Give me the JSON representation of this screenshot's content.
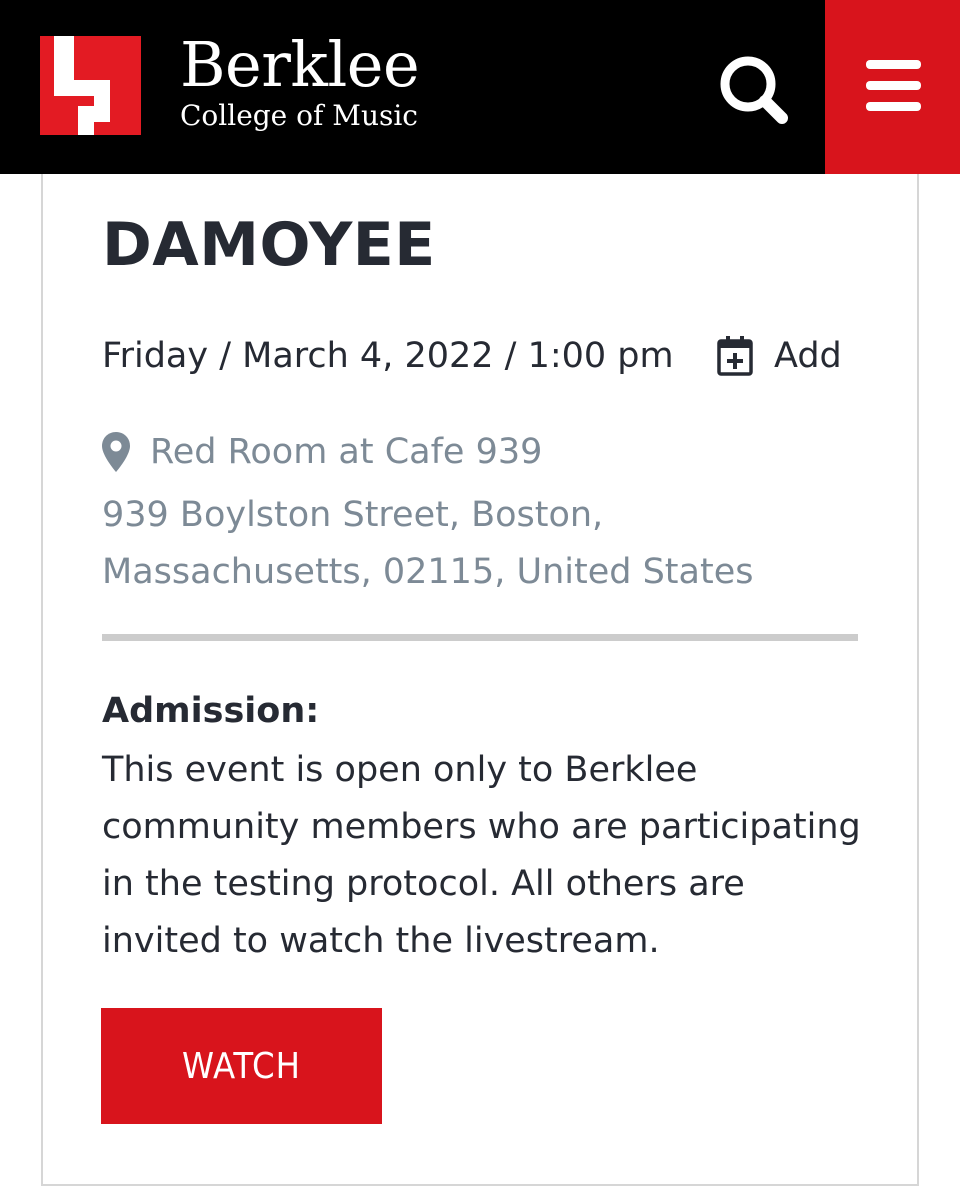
{
  "header": {
    "brand_name": "Berklee",
    "brand_sub": "College of Music",
    "logo_icon": "berklee-b-logo",
    "search_icon": "search-icon",
    "menu_icon": "hamburger-menu-icon",
    "colors": {
      "bar": "#000000",
      "accent": "#d8141c"
    }
  },
  "event": {
    "title": "DAMOYEE",
    "datetime": "Friday / March 4, 2022 / 1:00 pm",
    "add_label": "Add",
    "venue": "Red Room at Cafe 939",
    "address": "939 Boylston Street, Boston, Massachusetts, 02115, United States",
    "admission_heading": "Admission:",
    "admission_text": "This event is open only to Berklee community members who are participating in the testing protocol. All others are invited to watch the livestream.",
    "watch_label": "WATCH"
  }
}
